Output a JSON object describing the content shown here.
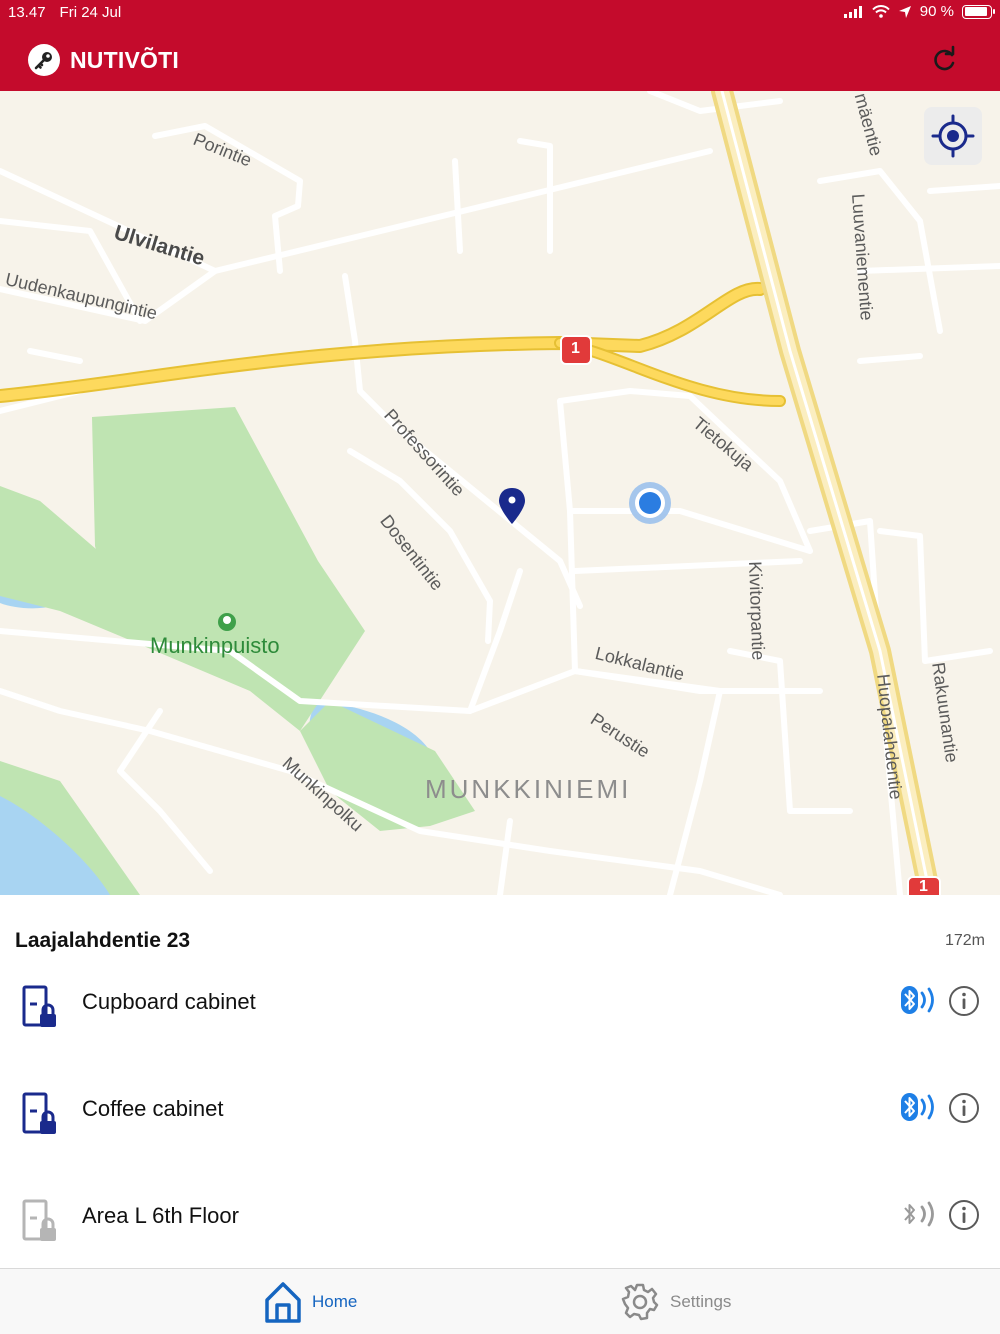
{
  "status_bar": {
    "time": "13.47",
    "date": "Fri 24 Jul",
    "battery": "90 %",
    "battery_level": 0.9
  },
  "app": {
    "title": "NUTIVÕTI"
  },
  "map": {
    "labels": {
      "porintie": "Porintie",
      "ulvilantie": "Ulvilantie",
      "uudenkaupungintie": "Uudenkaupungintie",
      "professorintie": "Professorintie",
      "dosentintie": "Dosentintie",
      "tietokuja": "Tietokuja",
      "kivitorpantie": "Kivitorpantie",
      "lokkalantie": "Lokkalantie",
      "perustie": "Perustie",
      "munkinpolku": "Munkinpolku",
      "munkkiniemi": "MUNKKINIEMI",
      "munkinpuisto": "Munkinpuisto",
      "huopalahdentie": "Huopalahdentie",
      "rakuunantie": "Rakuunantie",
      "luuvaniementie": "Luuvaniementie",
      "maentie": "mäentie",
      "road_shield": "1"
    }
  },
  "location": {
    "name": "Laajalahdentie 23",
    "distance": "172m"
  },
  "locks": [
    {
      "name": "Cupboard cabinet",
      "active": true
    },
    {
      "name": "Coffee cabinet",
      "active": true
    },
    {
      "name": "Area L 6th Floor",
      "active": false
    }
  ],
  "tabs": {
    "home": "Home",
    "settings": "Settings"
  },
  "colors": {
    "brand": "#c40b2c",
    "accent": "#1565c0",
    "lock_active": "#1a2a8c",
    "lock_inactive": "#b5b5b5"
  }
}
